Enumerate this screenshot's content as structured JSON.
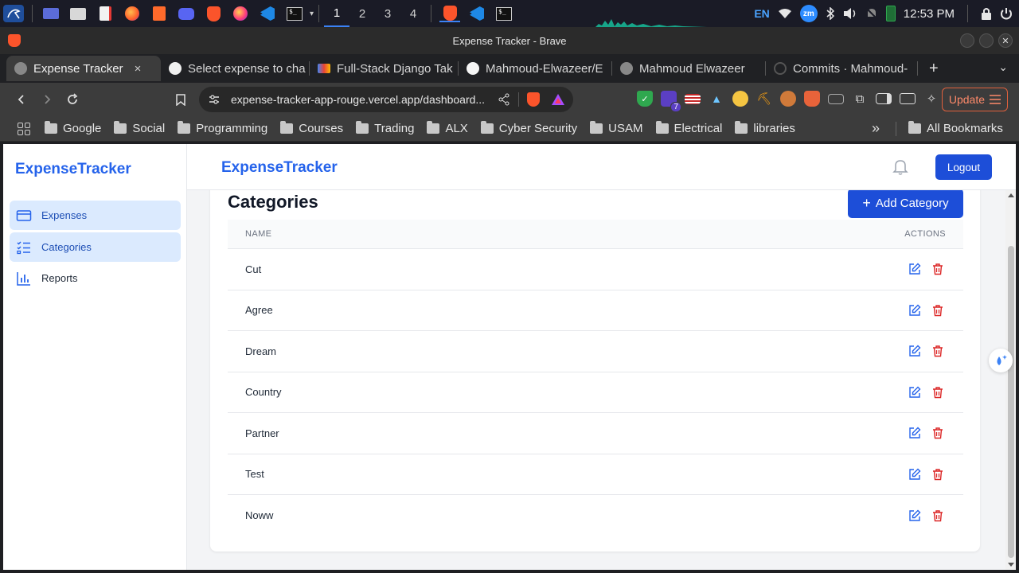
{
  "taskbar": {
    "workspaces": [
      "1",
      "2",
      "3",
      "4"
    ],
    "language": "EN",
    "clock": "12:53 PM"
  },
  "browser": {
    "window_title": "Expense Tracker - Brave",
    "tabs": [
      {
        "label": "Expense Tracker",
        "active": true
      },
      {
        "label": "Select expense to cha"
      },
      {
        "label": "Full-Stack Django Tak"
      },
      {
        "label": "Mahmoud-Elwazeer/E"
      },
      {
        "label": "Mahmoud Elwazeer"
      },
      {
        "label": "Commits · Mahmoud-"
      }
    ],
    "new_tab": "+",
    "close_tab": "×",
    "url": "expense-tracker-app-rouge.vercel.app/dashboard...",
    "extension_badge": "7",
    "update_label": "Update",
    "bookmarks": [
      "Google",
      "Social",
      "Programming",
      "Courses",
      "Trading",
      "ALX",
      "Cyber Security",
      "USAM",
      "Electrical",
      "libraries"
    ],
    "more_bookmarks": "»",
    "all_bookmarks": "All Bookmarks"
  },
  "app": {
    "sidebar_brand": "ExpenseTracker",
    "header_brand": "ExpenseTracker",
    "logout_label": "Logout",
    "nav": [
      {
        "label": "Expenses",
        "icon": "credit-card-icon"
      },
      {
        "label": "Categories",
        "icon": "list-icon"
      },
      {
        "label": "Reports",
        "icon": "bar-chart-icon"
      }
    ],
    "page_title": "Categories",
    "add_button_label": "Add Category",
    "table": {
      "headers": [
        "NAME",
        "ACTIONS"
      ],
      "rows": [
        "Cut",
        "Agree",
        "Dream",
        "Country",
        "Partner",
        "Test",
        "Noww"
      ]
    },
    "colors": {
      "brand": "#2563eb",
      "primary_button": "#1d4ed8",
      "edit_icon": "#2563eb",
      "delete_icon": "#dc2626",
      "active_nav_bg": "#dbeafe"
    }
  }
}
